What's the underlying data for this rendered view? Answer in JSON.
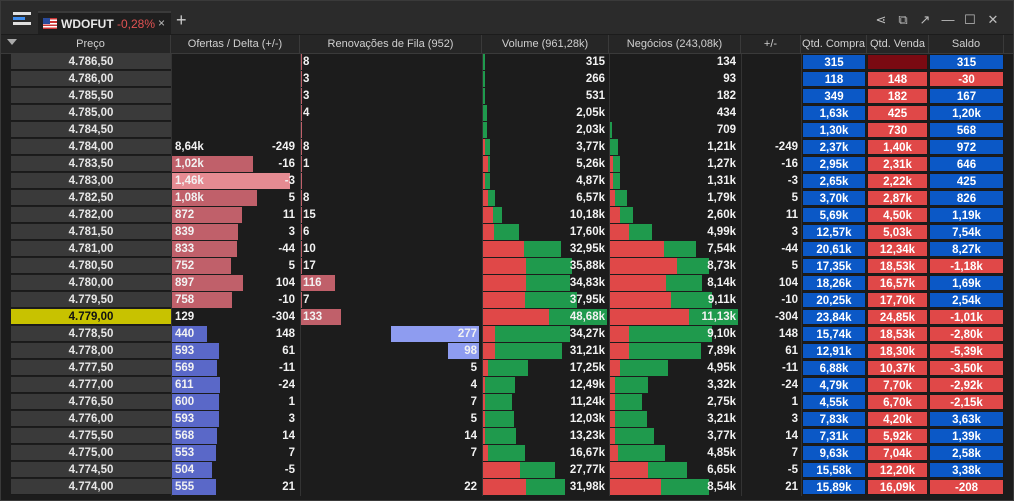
{
  "tab": {
    "symbol": "WDOFUT",
    "change": "-0,28%",
    "close": "×",
    "add": "+"
  },
  "colors": {
    "bid": "#5a68c8",
    "ask": "#c0606a",
    "green": "#1f9a4d",
    "red": "#e04848",
    "blue": "#0b58c6",
    "darkred": "#7a0a12",
    "cur": "#c8c200"
  },
  "headers": [
    "Preço",
    "Ofertas / Delta (+/-)",
    "Renovações de Fila (952)",
    "Volume (961,28k)",
    "Negócios (243,08k)",
    "+/-",
    "Qtd. Compra",
    "Qtd. Venda",
    "Saldo"
  ],
  "rows": [
    {
      "price": "4.786,50",
      "of": "",
      "ofv": 0,
      "delta": "",
      "ren": "8",
      "renv": 0,
      "vol": "315",
      "volr": 0,
      "volg": 0.01,
      "neg": "134",
      "negr": 0,
      "negg": 0,
      "pm": "",
      "qc": "315",
      "qv": "",
      "qvdark": true,
      "sal": "315",
      "salc": "blue"
    },
    {
      "price": "4.786,00",
      "of": "",
      "ofv": 0,
      "delta": "",
      "ren": "3",
      "renv": 0,
      "vol": "266",
      "volr": 0,
      "volg": 0.01,
      "neg": "93",
      "negr": 0,
      "negg": 0,
      "pm": "",
      "qc": "118",
      "qv": "148",
      "sal": "-30",
      "salc": "red"
    },
    {
      "price": "4.785,50",
      "of": "",
      "ofv": 0,
      "delta": "",
      "ren": "3",
      "renv": 0,
      "vol": "531",
      "volr": 0,
      "volg": 0.01,
      "neg": "182",
      "negr": 0,
      "negg": 0,
      "pm": "",
      "qc": "349",
      "qv": "182",
      "sal": "167",
      "salc": "blue"
    },
    {
      "price": "4.785,00",
      "of": "",
      "ofv": 0,
      "delta": "",
      "ren": "4",
      "renv": 0,
      "vol": "2,05k",
      "volr": 0,
      "volg": 0.03,
      "neg": "434",
      "negr": 0,
      "negg": 0,
      "pm": "",
      "qc": "1,63k",
      "qv": "425",
      "sal": "1,20k",
      "salc": "blue"
    },
    {
      "price": "4.784,50",
      "of": "",
      "ofv": 0,
      "delta": "",
      "ren": "",
      "renv": 0,
      "vol": "2,03k",
      "volr": 0,
      "volg": 0.03,
      "neg": "709",
      "negr": 0,
      "negg": 0.01,
      "pm": "",
      "qc": "1,30k",
      "qv": "730",
      "sal": "568",
      "salc": "blue"
    },
    {
      "price": "4.784,00",
      "of": "8,64k",
      "ofv": 0,
      "delta": "-249",
      "ren": "8",
      "renv": 0,
      "vol": "3,77k",
      "volr": 0.02,
      "volg": 0.06,
      "neg": "1,21k",
      "negr": 0,
      "negg": 0.06,
      "pm": "-249",
      "qc": "2,37k",
      "qv": "1,40k",
      "sal": "972",
      "salc": "blue"
    },
    {
      "price": "4.783,50",
      "of": "1,02k",
      "ofv": 0.69,
      "delta": "-16",
      "ren": "1",
      "renv": 0,
      "vol": "5,26k",
      "volr": 0.04,
      "volg": 0.06,
      "neg": "1,27k",
      "negr": 0.02,
      "negg": 0.08,
      "pm": "-16",
      "qc": "2,95k",
      "qv": "2,31k",
      "sal": "646",
      "salc": "blue"
    },
    {
      "price": "4.783,00",
      "of": "1,46k",
      "ofv": 1.0,
      "delta": "-3",
      "ren": "",
      "renv": 0,
      "vol": "4,87k",
      "volr": 0.02,
      "volg": 0.06,
      "neg": "1,31k",
      "negr": 0.02,
      "negg": 0.08,
      "pm": "-3",
      "qc": "2,65k",
      "qv": "2,22k",
      "sal": "425",
      "salc": "blue",
      "ofhl": true
    },
    {
      "price": "4.782,50",
      "of": "1,08k",
      "ofv": 0.72,
      "delta": "5",
      "ren": "8",
      "renv": 0,
      "vol": "6,57k",
      "volr": 0.04,
      "volg": 0.1,
      "neg": "1,79k",
      "negr": 0.04,
      "negg": 0.13,
      "pm": "5",
      "qc": "3,70k",
      "qv": "2,87k",
      "sal": "826",
      "salc": "blue"
    },
    {
      "price": "4.782,00",
      "of": "872",
      "ofv": 0.59,
      "delta": "11",
      "ren": "15",
      "renv": 0,
      "vol": "10,18k",
      "volr": 0.08,
      "volg": 0.15,
      "neg": "2,60k",
      "negr": 0.08,
      "negg": 0.18,
      "pm": "11",
      "qc": "5,69k",
      "qv": "4,50k",
      "sal": "1,19k",
      "salc": "blue"
    },
    {
      "price": "4.781,50",
      "of": "839",
      "ofv": 0.56,
      "delta": "3",
      "ren": "6",
      "renv": 0,
      "vol": "17,60k",
      "volr": 0.09,
      "volg": 0.29,
      "neg": "4,99k",
      "negr": 0.15,
      "negg": 0.33,
      "pm": "3",
      "qc": "12,57k",
      "qv": "5,03k",
      "sal": "7,54k",
      "salc": "blue"
    },
    {
      "price": "4.781,00",
      "of": "833",
      "ofv": 0.55,
      "delta": "-44",
      "ren": "10",
      "renv": 0,
      "vol": "32,95k",
      "volr": 0.33,
      "volg": 0.63,
      "neg": "7,54k",
      "negr": 0.42,
      "negg": 0.67,
      "pm": "-44",
      "qc": "20,61k",
      "qv": "12,34k",
      "sal": "8,27k",
      "salc": "blue"
    },
    {
      "price": "4.780,50",
      "of": "752",
      "ofv": 0.5,
      "delta": "5",
      "ren": "17",
      "renv": 0,
      "vol": "35,88k",
      "volr": 0.35,
      "volg": 0.72,
      "neg": "8,73k",
      "negr": 0.52,
      "negg": 0.77,
      "pm": "5",
      "qc": "17,35k",
      "qv": "18,53k",
      "sal": "-1,18k",
      "salc": "red"
    },
    {
      "price": "4.780,00",
      "of": "897",
      "ofv": 0.6,
      "delta": "104",
      "ren": "116",
      "renv": 0.19,
      "vol": "34,83k",
      "volr": 0.35,
      "volg": 0.7,
      "neg": "8,14k",
      "negr": 0.44,
      "negg": 0.72,
      "pm": "104",
      "qc": "18,26k",
      "qv": "16,57k",
      "sal": "1,69k",
      "salc": "blue"
    },
    {
      "price": "4.779,50",
      "of": "758",
      "ofv": 0.51,
      "delta": "-10",
      "ren": "7",
      "renv": 0,
      "vol": "37,95k",
      "volr": 0.34,
      "volg": 0.76,
      "neg": "9,11k",
      "negr": 0.48,
      "negg": 0.8,
      "pm": "-10",
      "qc": "20,25k",
      "qv": "17,70k",
      "sal": "2,54k",
      "salc": "blue"
    },
    {
      "price": "4.779,00",
      "of": "129",
      "ofv": 0,
      "delta": "-304",
      "ren": "133",
      "renv": 0.22,
      "vol": "48,68k",
      "volr": 0.53,
      "volg": 1.0,
      "neg": "11,13k",
      "negr": 0.62,
      "negg": 1.0,
      "pm": "-304",
      "qc": "23,84k",
      "qv": "24,85k",
      "sal": "-1,01k",
      "salc": "red",
      "cur": true
    },
    {
      "price": "4.778,50",
      "of": "440",
      "ofv": 0.3,
      "delta": "148",
      "ren": "277",
      "renv": 0.49,
      "vol": "34,27k",
      "volr": 0.1,
      "volg": 0.7,
      "neg": "9,10k",
      "negr": 0.15,
      "negg": 0.8,
      "pm": "148",
      "qc": "15,74k",
      "qv": "18,53k",
      "sal": "-2,80k",
      "salc": "red",
      "bid": true
    },
    {
      "price": "4.778,00",
      "of": "593",
      "ofv": 0.4,
      "delta": "61",
      "ren": "98",
      "renv": 0.17,
      "vol": "31,21k",
      "volr": 0.1,
      "volg": 0.64,
      "neg": "7,89k",
      "negr": 0.15,
      "negg": 0.71,
      "pm": "61",
      "qc": "12,91k",
      "qv": "18,30k",
      "sal": "-5,39k",
      "salc": "red",
      "bid": true
    },
    {
      "price": "4.777,50",
      "of": "569",
      "ofv": 0.38,
      "delta": "-11",
      "ren": "5",
      "renv": 0,
      "vol": "17,25k",
      "volr": 0.04,
      "volg": 0.36,
      "neg": "4,95k",
      "negr": 0.08,
      "negg": 0.45,
      "pm": "-11",
      "qc": "6,88k",
      "qv": "10,37k",
      "sal": "-3,50k",
      "salc": "red",
      "bid": true
    },
    {
      "price": "4.777,00",
      "of": "611",
      "ofv": 0.41,
      "delta": "-24",
      "ren": "4",
      "renv": 0,
      "vol": "12,49k",
      "volr": 0.02,
      "volg": 0.26,
      "neg": "3,32k",
      "negr": 0.04,
      "negg": 0.3,
      "pm": "-24",
      "qc": "4,79k",
      "qv": "7,70k",
      "sal": "-2,92k",
      "salc": "red",
      "bid": true
    },
    {
      "price": "4.776,50",
      "of": "600",
      "ofv": 0.4,
      "delta": "1",
      "ren": "7",
      "renv": 0,
      "vol": "11,24k",
      "volr": 0.02,
      "volg": 0.23,
      "neg": "2,75k",
      "negr": 0.04,
      "negg": 0.25,
      "pm": "1",
      "qc": "4,55k",
      "qv": "6,70k",
      "sal": "-2,15k",
      "salc": "red",
      "bid": true
    },
    {
      "price": "4.776,00",
      "of": "593",
      "ofv": 0.4,
      "delta": "3",
      "ren": "5",
      "renv": 0,
      "vol": "12,03k",
      "volr": 0.02,
      "volg": 0.25,
      "neg": "3,21k",
      "negr": 0.04,
      "negg": 0.29,
      "pm": "3",
      "qc": "7,83k",
      "qv": "4,20k",
      "sal": "3,63k",
      "salc": "blue",
      "bid": true
    },
    {
      "price": "4.775,50",
      "of": "568",
      "ofv": 0.38,
      "delta": "14",
      "ren": "14",
      "renv": 0,
      "vol": "13,23k",
      "volr": 0.02,
      "volg": 0.27,
      "neg": "3,77k",
      "negr": 0.04,
      "negg": 0.34,
      "pm": "14",
      "qc": "7,31k",
      "qv": "5,92k",
      "sal": "1,39k",
      "salc": "blue",
      "bid": true
    },
    {
      "price": "4.775,00",
      "of": "553",
      "ofv": 0.37,
      "delta": "7",
      "ren": "7",
      "renv": 0,
      "vol": "16,67k",
      "volr": 0.04,
      "volg": 0.34,
      "neg": "4,85k",
      "negr": 0.06,
      "negg": 0.43,
      "pm": "7",
      "qc": "9,63k",
      "qv": "7,04k",
      "sal": "2,58k",
      "salc": "blue",
      "bid": true
    },
    {
      "price": "4.774,50",
      "of": "504",
      "ofv": 0.34,
      "delta": "-5",
      "ren": "",
      "renv": 0,
      "vol": "27,77k",
      "volr": 0.3,
      "volg": 0.58,
      "neg": "6,65k",
      "negr": 0.3,
      "negg": 0.6,
      "pm": "-5",
      "qc": "15,58k",
      "qv": "12,20k",
      "sal": "3,38k",
      "salc": "blue",
      "bid": true
    },
    {
      "price": "4.774,00",
      "of": "555",
      "ofv": 0.37,
      "delta": "21",
      "ren": "22",
      "renv": 0,
      "vol": "31,98k",
      "volr": 0.35,
      "volg": 0.66,
      "neg": "8,54k",
      "negr": 0.4,
      "negg": 0.77,
      "pm": "21",
      "qc": "15,89k",
      "qv": "16,09k",
      "sal": "-208",
      "salc": "red",
      "bid": true
    }
  ]
}
